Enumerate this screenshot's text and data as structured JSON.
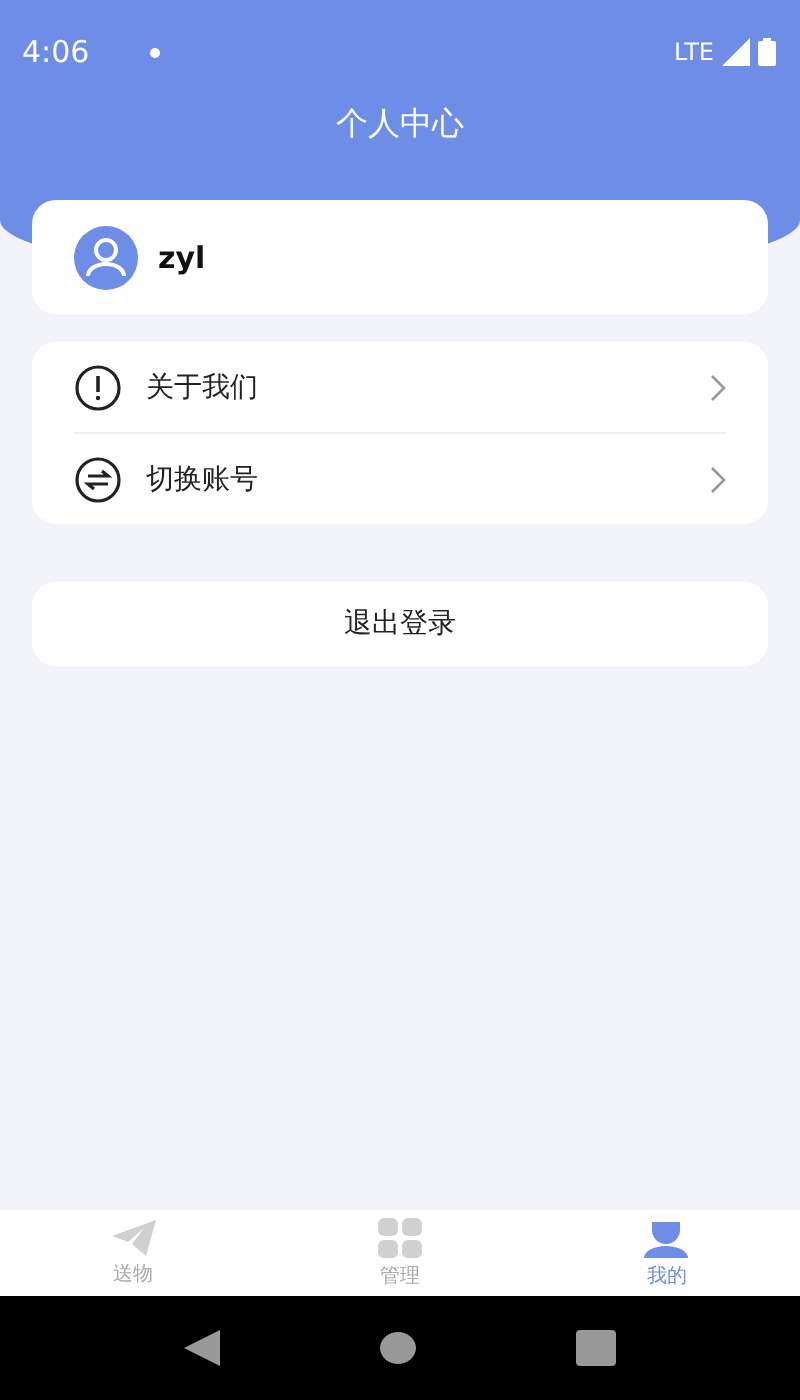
{
  "status_bar": {
    "time": "4:06",
    "network": "LTE"
  },
  "header": {
    "title": "个人中心"
  },
  "profile": {
    "username": "zyl"
  },
  "menu": [
    {
      "kind": "info",
      "label": "关于我们"
    },
    {
      "kind": "switch",
      "label": "切换账号"
    }
  ],
  "logout_button": "退出登录",
  "tab_bar": [
    {
      "kind": "send",
      "label": "送物",
      "selected": false
    },
    {
      "kind": "manage",
      "label": "管理",
      "selected": false
    },
    {
      "kind": "mine",
      "label": "我的",
      "selected": true
    }
  ]
}
